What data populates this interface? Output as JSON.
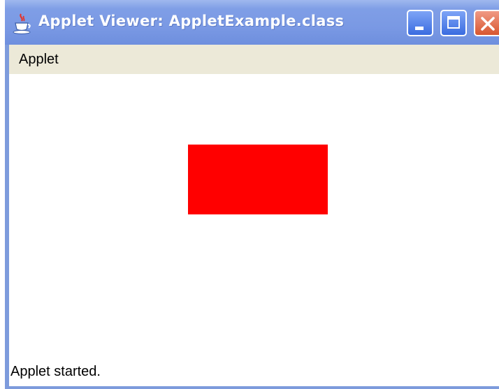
{
  "window": {
    "title": "Applet Viewer: AppletExample.class",
    "icon": "java-cup-icon",
    "controls": [
      "minimize-icon",
      "maximize-icon",
      "close-icon"
    ]
  },
  "menubar": {
    "items": [
      {
        "label": "Applet"
      }
    ]
  },
  "applet": {
    "shape": "rectangle",
    "fill_color": "#ff0000"
  },
  "status": {
    "text": "Applet started."
  },
  "colors": {
    "titlebar": "#7a99e4",
    "close_button": "#d8562f",
    "menubar": "#ece9d8"
  }
}
